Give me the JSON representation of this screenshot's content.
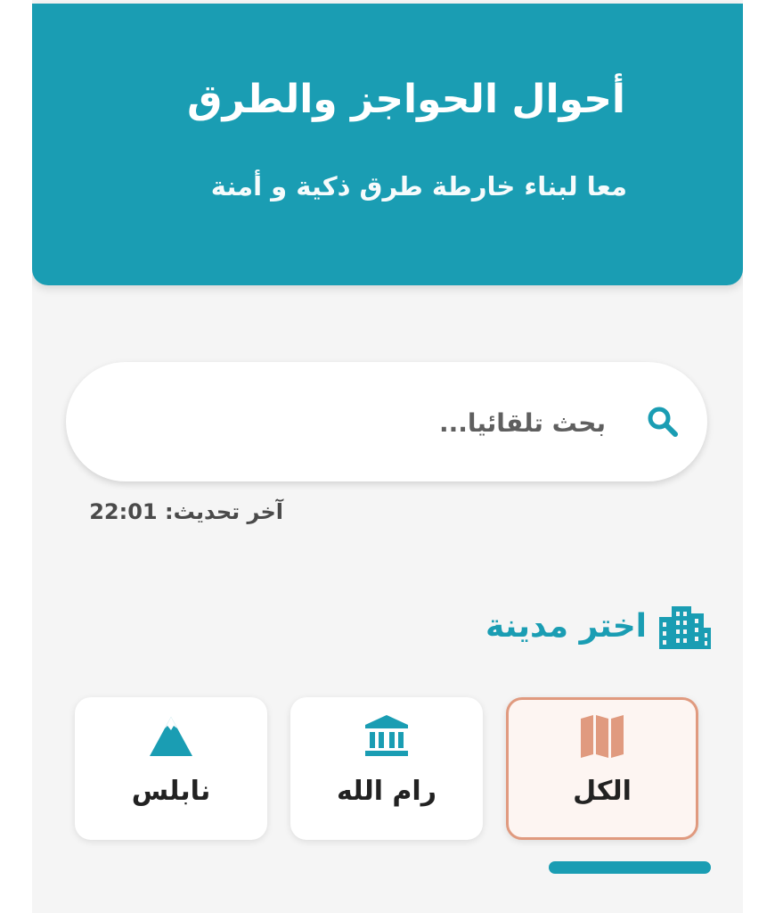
{
  "header": {
    "title": "أحوال الحواجز والطرق",
    "subtitle": "معا لبناء خارطة طرق ذكية و أمنة"
  },
  "search": {
    "placeholder": "بحث تلقائيا...",
    "value": "",
    "icon": "search-icon"
  },
  "last_update": {
    "label": "آخر تحديث:",
    "time": "22:01"
  },
  "city_section": {
    "title": "اختر مدينة",
    "icon": "city-buildings-icon"
  },
  "cities": [
    {
      "label": "الكل",
      "icon": "map-icon",
      "selected": true
    },
    {
      "label": "رام الله",
      "icon": "landmark-icon",
      "selected": false
    },
    {
      "label": "نابلس",
      "icon": "mountain-icon",
      "selected": false
    }
  ],
  "colors": {
    "primary": "#1a9db3",
    "selected_accent": "#e09a7f",
    "background": "#f5f5f5"
  }
}
